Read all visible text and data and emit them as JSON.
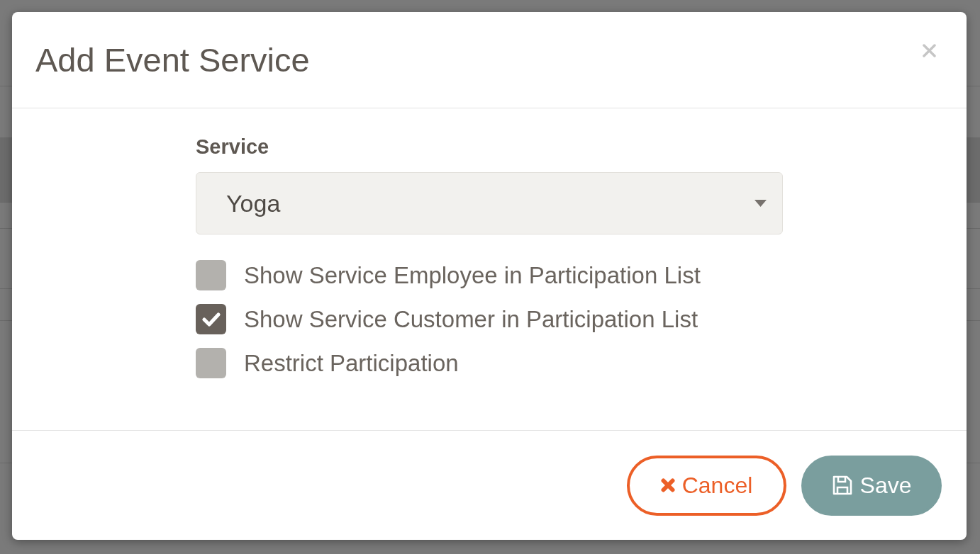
{
  "dialog": {
    "title": "Add Event Service"
  },
  "form": {
    "service": {
      "label": "Service",
      "value": "Yoga"
    },
    "options": [
      {
        "label": "Show Service Employee in Participation List",
        "checked": false
      },
      {
        "label": "Show Service Customer in Participation List",
        "checked": true
      },
      {
        "label": "Restrict Participation",
        "checked": false
      }
    ]
  },
  "buttons": [
    {
      "kind": "cancel",
      "label": "Cancel"
    },
    {
      "kind": "save",
      "label": "Save"
    }
  ]
}
